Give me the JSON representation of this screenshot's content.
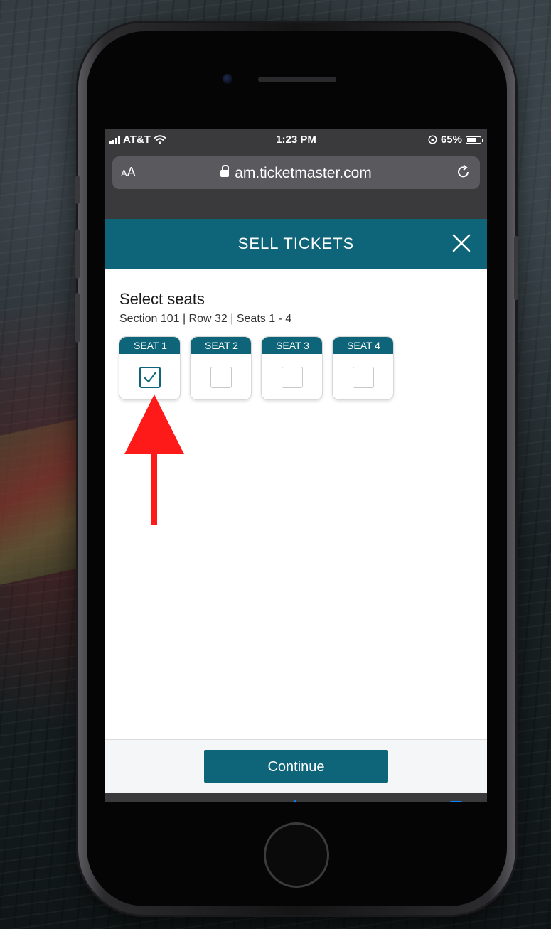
{
  "status_bar": {
    "carrier": "AT&T",
    "time": "1:23 PM",
    "battery": "65%",
    "battery_level": 0.65
  },
  "browser": {
    "text_size_label_small": "A",
    "text_size_label_large": "A",
    "url": "am.ticketmaster.com"
  },
  "app_header": {
    "title": "SELL TICKETS"
  },
  "content": {
    "heading": "Select seats",
    "subheading": "Section 101 | Row 32 | Seats 1 - 4",
    "seats": [
      {
        "label": "SEAT 1",
        "checked": true
      },
      {
        "label": "SEAT 2",
        "checked": false
      },
      {
        "label": "SEAT 3",
        "checked": false
      },
      {
        "label": "SEAT 4",
        "checked": false
      }
    ]
  },
  "footer": {
    "continue_label": "Continue"
  },
  "icons": {
    "accent": "#0e6479",
    "toolbar_active": "#0a84ff",
    "toolbar_disabled": "#5a6a7e",
    "annotation_arrow": "#ff1a1a"
  }
}
